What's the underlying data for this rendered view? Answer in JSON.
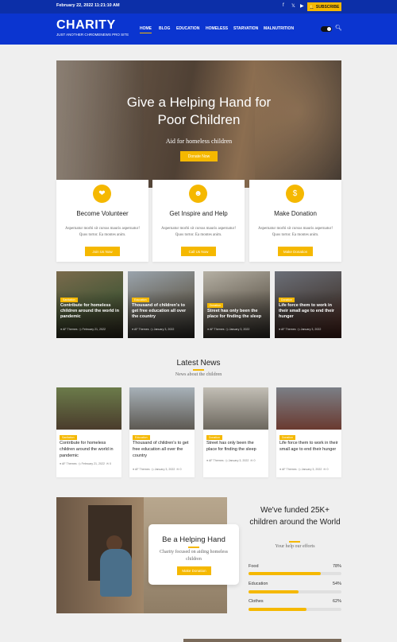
{
  "topbar": {
    "date": "February 22, 2022 11:21:10 AM",
    "social_icons": [
      "facebook-icon",
      "twitter-icon",
      "youtube-icon"
    ],
    "subscribe_label": "SUBSCRIBE"
  },
  "header": {
    "logo": "CHARITY",
    "tagline": "JUST ANOTHER CHROMENEWS PRO SITE",
    "nav": [
      "HOME",
      "BLOG",
      "EDUCATION",
      "HOMELESS",
      "STARVATION",
      "MALNUTRITION"
    ],
    "active_nav": "HOME"
  },
  "hero": {
    "title_line1": "Give a Helping Hand for",
    "title_line2": "Poor Children",
    "subtitle": "Aid for homeless children",
    "button": "Donate Now"
  },
  "features": [
    {
      "icon": "heart-hand-icon",
      "title": "Become Volunteer",
      "text": "Aspernatur morbi sit cursus mauris aspernatur! Quos tortor. Ea montes anim.",
      "button": "Join Us Now"
    },
    {
      "icon": "person-icon",
      "title": "Get Inspire and Help",
      "text": "Aspernatur morbi sit cursus mauris aspernatur! Quos tortor. Ea montes anim.",
      "button": "Call Us Now"
    },
    {
      "icon": "donation-icon",
      "title": "Make Donation",
      "text": "Aspernatur morbi sit cursus mauris aspernatur! Quos tortor. Ea montes anim.",
      "button": "Make Donation"
    }
  ],
  "overlay_posts": [
    {
      "tag": "Sanitation",
      "title": "Contribute for homeless children around the world in pandemic",
      "author": "AF Themes",
      "date": "February 21, 2022"
    },
    {
      "tag": "Education",
      "title": "Thousand of children's to get free education all over the country",
      "author": "AF Themes",
      "date": "January 3, 2022"
    },
    {
      "tag": "Donation",
      "title": "Street has only been the place for finding the sleep",
      "author": "AF Themes",
      "date": "January 3, 2022"
    },
    {
      "tag": "Donation",
      "title": "Life force them to work in their small age to end their hunger",
      "author": "AF Themes",
      "date": "January 3, 2022"
    }
  ],
  "latest": {
    "title": "Latest News",
    "subtitle": "News about the children",
    "posts": [
      {
        "tag": "Sanitation",
        "title": "Contribute for homeless children around the world in pandemic",
        "author": "AF Themes",
        "date": "February 21, 2022",
        "comments": "0"
      },
      {
        "tag": "Education",
        "title": "Thousand of children's to get free education all over the country",
        "author": "AF Themes",
        "date": "January 3, 2022",
        "comments": "0"
      },
      {
        "tag": "Donation",
        "title": "Street has only been the place for finding the sleep",
        "author": "AF Themes",
        "date": "January 3, 2022",
        "comments": "0"
      },
      {
        "tag": "Donation",
        "title": "Life force them to work in their small age to end their hunger",
        "author": "AF Themes",
        "date": "January 3, 2022",
        "comments": "0"
      }
    ]
  },
  "help_card": {
    "title": "Be a Helping Hand",
    "text": "Charity focused on aiding homeless children",
    "button": "Make Donation"
  },
  "funding": {
    "title": "We've funded 25K+ children around the World",
    "subtitle": "Your help our efforts",
    "items": [
      {
        "label": "Food",
        "value": "78%",
        "percent": 78
      },
      {
        "label": "Education",
        "value": "54%",
        "percent": 54
      },
      {
        "label": "Clothes",
        "value": "62%",
        "percent": 62
      }
    ]
  },
  "colors": {
    "brand": "#0b35d0",
    "topbar": "#0c2fa8",
    "accent": "#f5b800"
  }
}
